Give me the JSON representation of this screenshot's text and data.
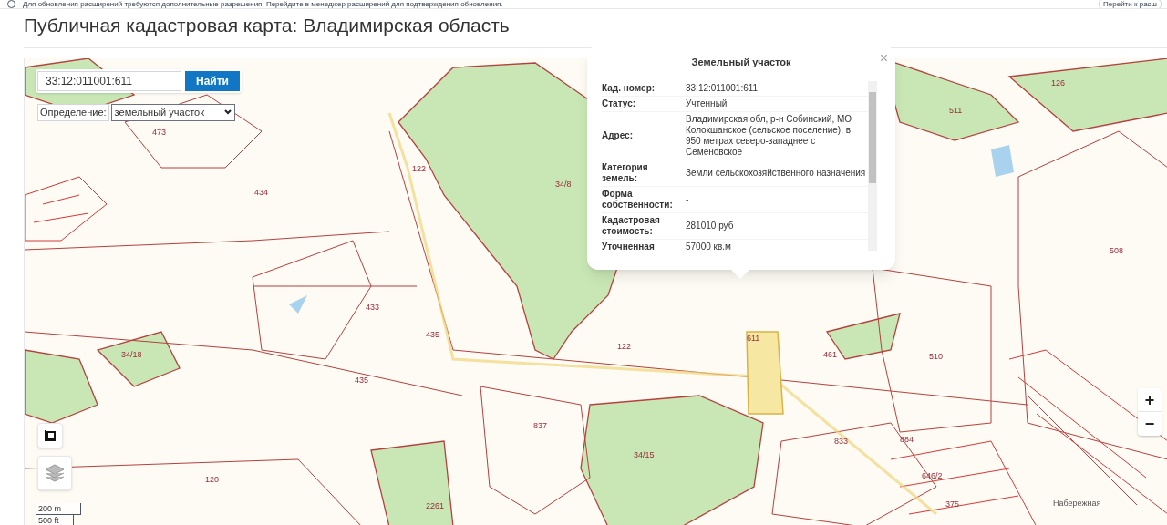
{
  "notice": {
    "text": "Для обновления расширений требуются дополнительные разрешения. Перейдите в менеджер расширений для подтверждения обновления.",
    "button": "Перейти к расш"
  },
  "title": "Публичная кадастровая карта: Владимирская область",
  "search": {
    "value": "33:12:011001:611",
    "button": "Найти"
  },
  "definition": {
    "label": "Определение:",
    "value": "земельный участок"
  },
  "popup": {
    "title": "Земельный участок",
    "close": "×",
    "rows": [
      {
        "label": "Кад. номер:",
        "value": "33:12:011001:611"
      },
      {
        "label": "Статус:",
        "value": "Учтенный"
      },
      {
        "label": "Адрес:",
        "value": "Владимирская обл, р-н Собинский, МО Колокшанское (сельское поселение), в 950 метрах северо-западнее с Семеновское"
      },
      {
        "label": "Категория земель:",
        "value": "Земли сельскохозяйственного назначения"
      },
      {
        "label": "Форма собственности:",
        "value": "-"
      },
      {
        "label": "Кадастровая стоимость:",
        "value": "281010 руб"
      },
      {
        "label": "Уточненная",
        "value": "57000 кв.м"
      }
    ]
  },
  "parcel_labels": [
    "473",
    "434",
    "34/8",
    "122",
    "433",
    "34/18",
    "435",
    "435",
    "122",
    "611",
    "461",
    "510",
    "508",
    "511",
    "126",
    "837",
    "34/15",
    "833",
    "884",
    "646/2",
    "375",
    "120",
    "2261"
  ],
  "street_label": "Набережная",
  "scale": {
    "metric": "200 m",
    "imperial": "500 ft"
  },
  "zoom": {
    "in": "+",
    "out": "−"
  }
}
